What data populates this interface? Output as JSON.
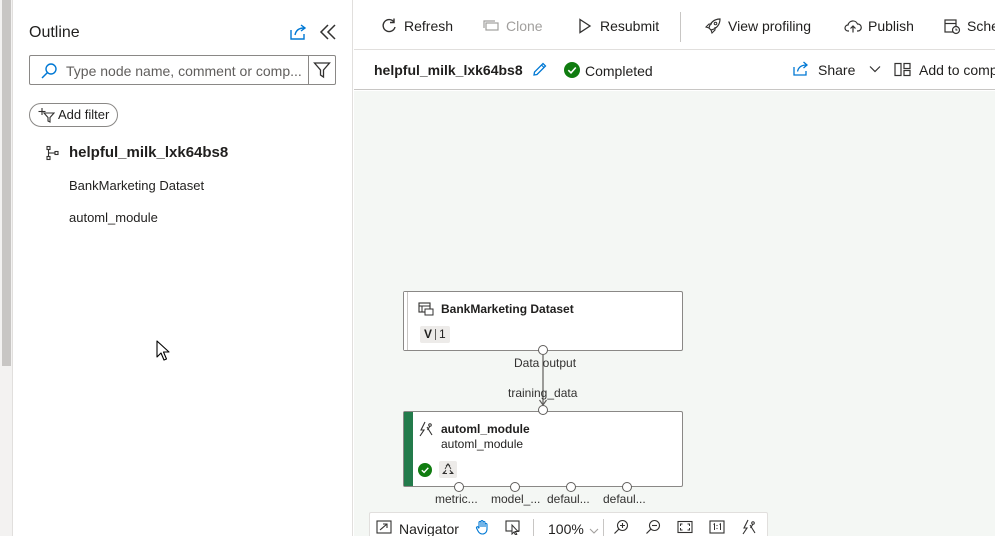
{
  "outline": {
    "title": "Outline",
    "search_placeholder": "Type node name, comment or comp...",
    "add_filter_label": "Add filter",
    "root_label": "helpful_milk_lxk64bs8",
    "items": [
      {
        "label": "BankMarketing Dataset"
      },
      {
        "label": "automl_module"
      }
    ]
  },
  "toolbar": {
    "refresh": "Refresh",
    "clone": "Clone",
    "resubmit": "Resubmit",
    "view_profiling": "View profiling",
    "publish": "Publish",
    "schedule": "Sche"
  },
  "run": {
    "name": "helpful_milk_lxk64bs8",
    "status": "Completed",
    "share_label": "Share",
    "add_component_label": "Add to comp"
  },
  "graph": {
    "dataset_node": {
      "title": "BankMarketing Dataset",
      "version_prefix": "V",
      "version": "1",
      "output_port": "Data output"
    },
    "module_node": {
      "title": "automl_module",
      "subtitle": "automl_module",
      "input_port": "training_data",
      "output_ports": [
        "metric...",
        "model_...",
        "defaul...",
        "defaul..."
      ]
    }
  },
  "navigator": {
    "label": "Navigator",
    "zoom": "100%"
  },
  "colors": {
    "accent": "#0078d4",
    "success": "#107c10",
    "module_bar": "#237b4b",
    "canvas_bg": "#f4f7f4"
  }
}
